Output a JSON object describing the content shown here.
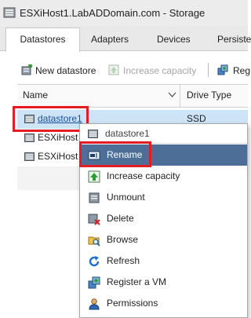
{
  "window": {
    "title": "ESXiHost1.LabADDomain.com - Storage"
  },
  "tabs": [
    {
      "label": "Datastores",
      "active": true
    },
    {
      "label": "Adapters",
      "active": false
    },
    {
      "label": "Devices",
      "active": false
    },
    {
      "label": "Persiste",
      "active": false
    }
  ],
  "toolbar": {
    "new_datastore": "New datastore",
    "increase_capacity": "Increase capacity",
    "register": "Reg"
  },
  "grid": {
    "columns": {
      "name": "Name",
      "drive_type": "Drive Type"
    },
    "rows": [
      {
        "name": "datastore1",
        "drive_type": "SSD"
      },
      {
        "name": "ESXiHost"
      },
      {
        "name": "ESXiHost"
      }
    ]
  },
  "context_menu": {
    "header": "datastore1",
    "items": [
      {
        "label": "Rename",
        "icon": "rename-icon"
      },
      {
        "label": "Increase capacity",
        "icon": "increase-capacity-icon"
      },
      {
        "label": "Unmount",
        "icon": "unmount-icon"
      },
      {
        "label": "Delete",
        "icon": "delete-icon"
      },
      {
        "label": "Browse",
        "icon": "browse-icon"
      },
      {
        "label": "Refresh",
        "icon": "refresh-icon"
      },
      {
        "label": "Register a VM",
        "icon": "register-vm-icon"
      },
      {
        "label": "Permissions",
        "icon": "permissions-icon"
      }
    ]
  },
  "colors": {
    "highlight_red": "#e51c23",
    "menu_hover": "#4d6f97",
    "row_selected": "#cde4f7"
  }
}
